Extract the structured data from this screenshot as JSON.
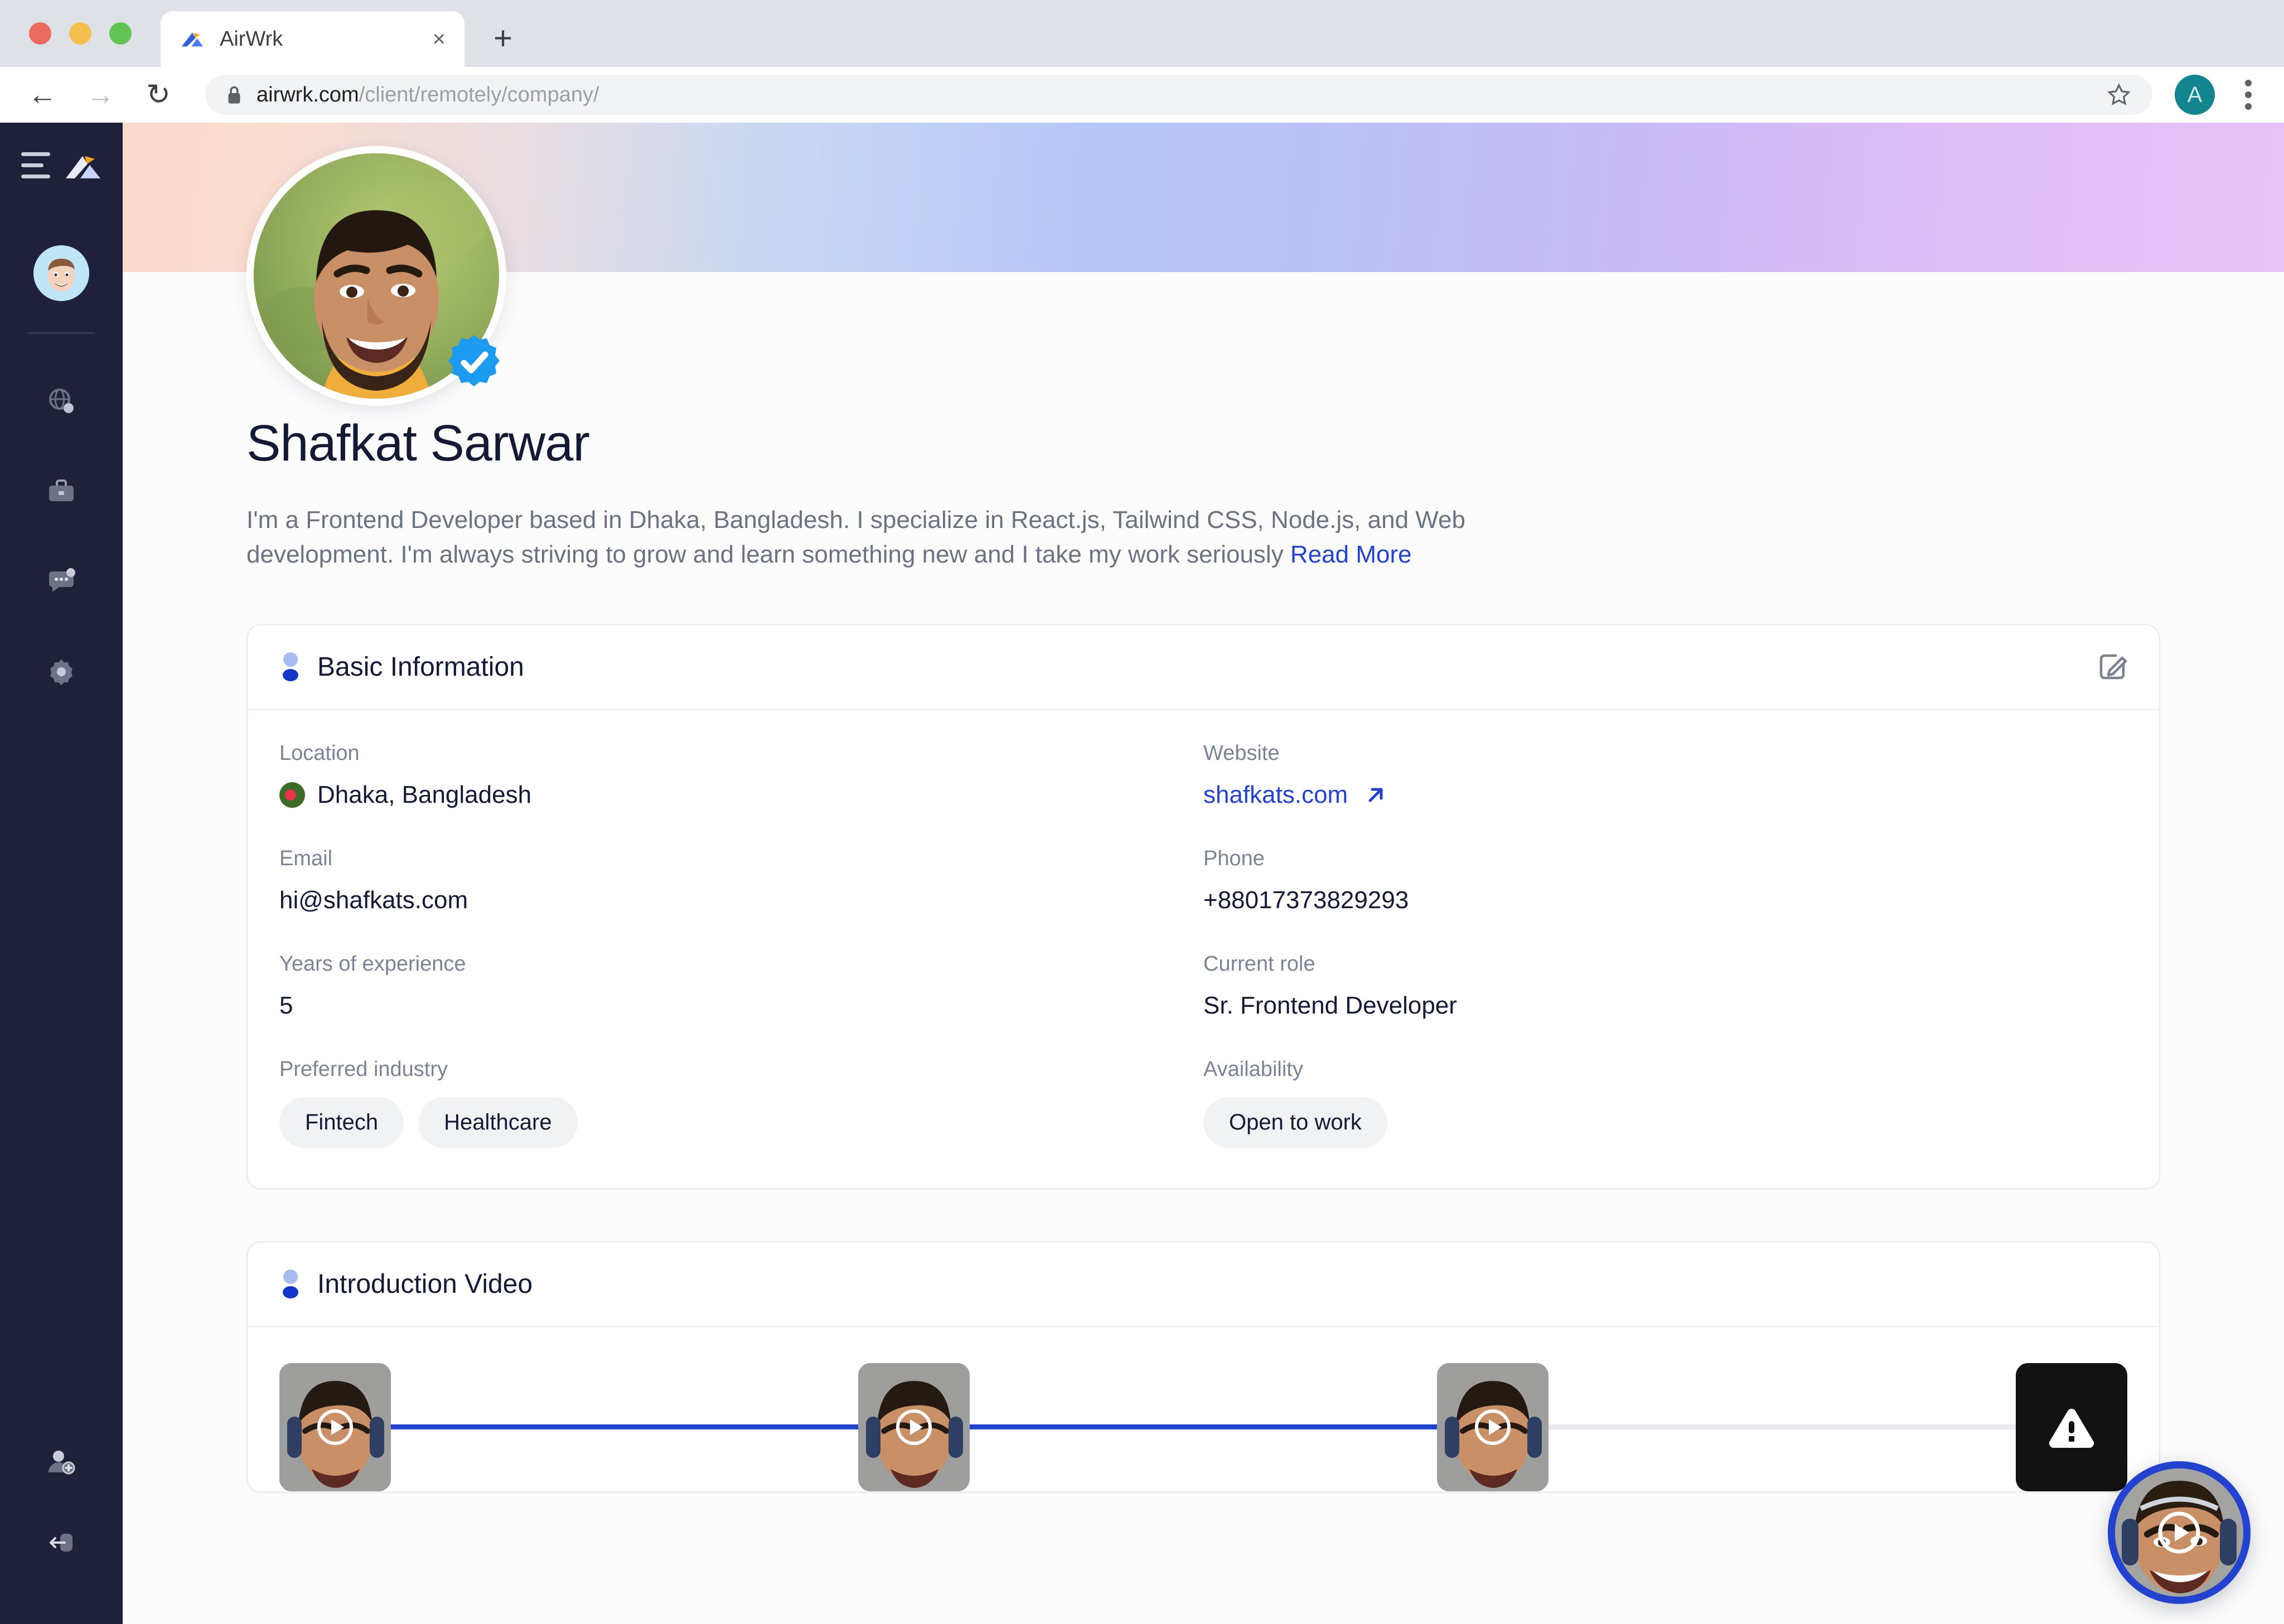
{
  "browser": {
    "tab": {
      "title": "AirWrk",
      "favicon": "airwrk-logo-icon",
      "close": "×"
    },
    "new_tab_label": "+",
    "nav": {
      "back": "←",
      "forward": "→",
      "reload": "↻"
    },
    "url_domain": "airwrk.com",
    "url_path": "/client/remotely/company/",
    "bookmark_icon": "star-icon",
    "profile_initial": "A",
    "menu_icon": "kebab-menu-icon"
  },
  "sidebar": {
    "menu_icon": "hamburger-icon",
    "logo_icon": "airwrk-logo-icon",
    "avatar_icon": "user-memoji-avatar",
    "items": [
      {
        "icon": "globe-search-icon",
        "name": "discover"
      },
      {
        "icon": "briefcase-icon",
        "name": "jobs"
      },
      {
        "icon": "chat-bubble-icon",
        "name": "messages"
      },
      {
        "icon": "gear-icon",
        "name": "settings"
      }
    ],
    "bottom_items": [
      {
        "icon": "add-user-icon",
        "name": "invite"
      },
      {
        "icon": "logout-icon",
        "name": "logout"
      }
    ]
  },
  "profile": {
    "avatar": "profile-photo",
    "verified_badge": "verified-check-icon",
    "name": "Shafkat Sarwar",
    "bio_text": "I'm a Frontend Developer based in Dhaka, Bangladesh. I specialize in React.js, Tailwind CSS, Node.js, and Web development. I'm always striving to grow and learn something new and I take my work seriously ",
    "read_more": "Read More"
  },
  "basic_information": {
    "title": "Basic Information",
    "icon": "person-icon",
    "edit_icon": "edit-pencil-icon",
    "fields": {
      "location_label": "Location",
      "location_value": "Dhaka, Bangladesh",
      "location_flag": "bangladesh-flag-icon",
      "website_label": "Website",
      "website_value": "shafkats.com",
      "website_link_icon": "external-link-icon",
      "email_label": "Email",
      "email_value": "hi@shafkats.com",
      "phone_label": "Phone",
      "phone_value": "+88017373829293",
      "experience_label": "Years of experience",
      "experience_value": "5",
      "role_label": "Current role",
      "role_value": "Sr. Frontend Developer",
      "industry_label": "Preferred industry",
      "industry_values": [
        "Fintech",
        "Healthcare"
      ],
      "availability_label": "Availability",
      "availability_value": "Open to work"
    }
  },
  "introduction_video": {
    "title": "Introduction Video",
    "icon": "person-icon",
    "thumbnails": [
      {
        "type": "photo",
        "state": "done",
        "icon": "play-icon"
      },
      {
        "type": "photo",
        "state": "done",
        "icon": "play-icon"
      },
      {
        "type": "photo",
        "state": "current",
        "icon": "play-icon"
      },
      {
        "type": "error",
        "state": "pending",
        "icon": "warning-icon"
      }
    ],
    "segments": [
      "active",
      "active",
      "inactive"
    ]
  },
  "floating_video": {
    "icon": "play-icon",
    "ring_color": "#2343cf"
  },
  "colors": {
    "accent": "#2343cf",
    "sidebar_bg": "#1e2139",
    "text_primary": "#141a33",
    "text_muted": "#7c8494",
    "chip_bg": "#f1f2f4"
  }
}
